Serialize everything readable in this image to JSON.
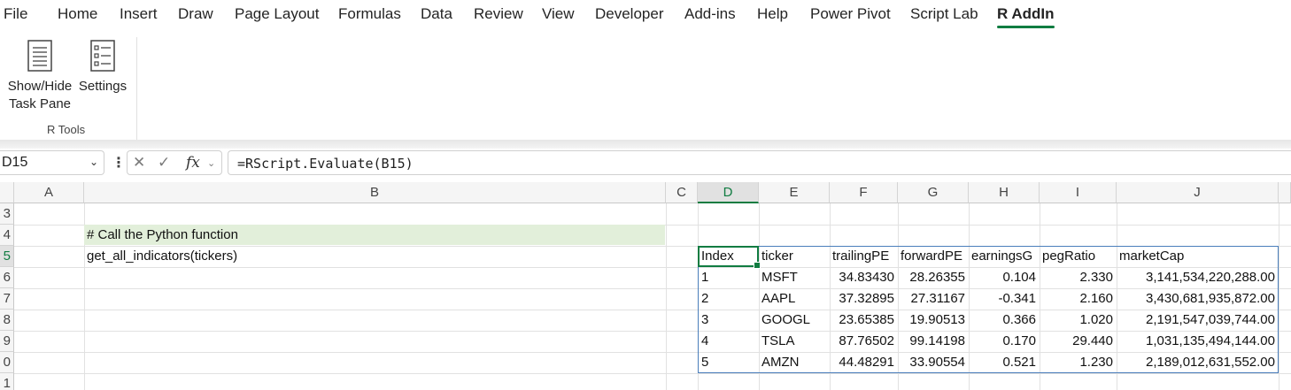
{
  "menu": {
    "items": [
      "File",
      "Home",
      "Insert",
      "Draw",
      "Page Layout",
      "Formulas",
      "Data",
      "Review",
      "View",
      "Developer",
      "Add-ins",
      "Help",
      "Power Pivot",
      "Script Lab",
      "R AddIn"
    ],
    "active": "R AddIn",
    "accent_color": "#107c41"
  },
  "ribbon": {
    "show_hide_label_1": "Show/Hide",
    "show_hide_label_2": "Task Pane",
    "settings_label": "Settings",
    "group_label": "R Tools"
  },
  "formula_bar": {
    "name_box": "D15",
    "formula": "=RScript.Evaluate(B15)",
    "fx_label": "fx"
  },
  "grid": {
    "columns": [
      "A",
      "B",
      "C",
      "D",
      "E",
      "F",
      "G",
      "H",
      "I",
      "J"
    ],
    "selected_column": "D",
    "rows": [
      "3",
      "4",
      "5",
      "6",
      "7",
      "8",
      "9",
      "0",
      "1"
    ],
    "selected_row": "5",
    "b14": "# Call the Python function",
    "b15": "get_all_indicators(tickers)",
    "comment_fill_color": "#e2efda",
    "table": {
      "headers": [
        "Index",
        "ticker",
        "trailingPE",
        "forwardPE",
        "earningsG",
        "pegRatio",
        "marketCap"
      ],
      "rows": [
        [
          "1",
          "MSFT",
          "34.83430",
          "28.26355",
          "0.104",
          "2.330",
          "3,141,534,220,288.00"
        ],
        [
          "2",
          "AAPL",
          "37.32895",
          "27.31167",
          "-0.341",
          "2.160",
          "3,430,681,935,872.00"
        ],
        [
          "3",
          "GOOGL",
          "23.65385",
          "19.90513",
          "0.366",
          "1.020",
          "2,191,547,039,744.00"
        ],
        [
          "4",
          "TSLA",
          "87.76502",
          "99.14198",
          "0.170",
          "29.440",
          "1,031,135,494,144.00"
        ],
        [
          "5",
          "AMZN",
          "44.48291",
          "33.90554",
          "0.521",
          "1.230",
          "2,189,012,631,552.00"
        ]
      ]
    }
  }
}
